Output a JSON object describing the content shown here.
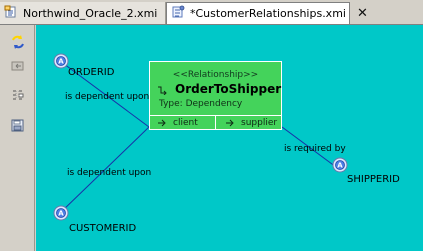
{
  "tabs": [
    {
      "label": "Northwind_Oracle_2.xmi",
      "icon": "xmi-model-icon"
    },
    {
      "label": "*CustomerRelationships.xmi",
      "icon": "xmi-diagram-icon",
      "close_symbol": "✕"
    }
  ],
  "toolbar": {
    "items": [
      {
        "icon": "refresh-icon"
      },
      {
        "icon": "up-folder-icon"
      },
      {
        "icon": "layout-icon"
      },
      {
        "icon": "save-diagram-icon"
      }
    ]
  },
  "diagram": {
    "nodes": {
      "orderid": {
        "label": "ORDERID",
        "icon": "entity-a-icon"
      },
      "customerid": {
        "label": "CUSTOMERID",
        "icon": "entity-a-icon"
      },
      "shipperid": {
        "label": "SHIPPERID",
        "icon": "entity-a-icon"
      }
    },
    "edges": {
      "order_to_center": "is dependent upon",
      "customer_to_center": "is dependent upon",
      "center_to_shipper": "is required by"
    },
    "relationship": {
      "stereotype": "<<Relationship>>",
      "name": "OrderToShipper",
      "type": "Type: Dependency",
      "client": "client",
      "supplier": "supplier"
    }
  },
  "colors": {
    "canvas": "#00c8c8",
    "relationship_fill": "#44d35b",
    "connector": "#1830a8",
    "relationship_border": "#ffffff"
  }
}
